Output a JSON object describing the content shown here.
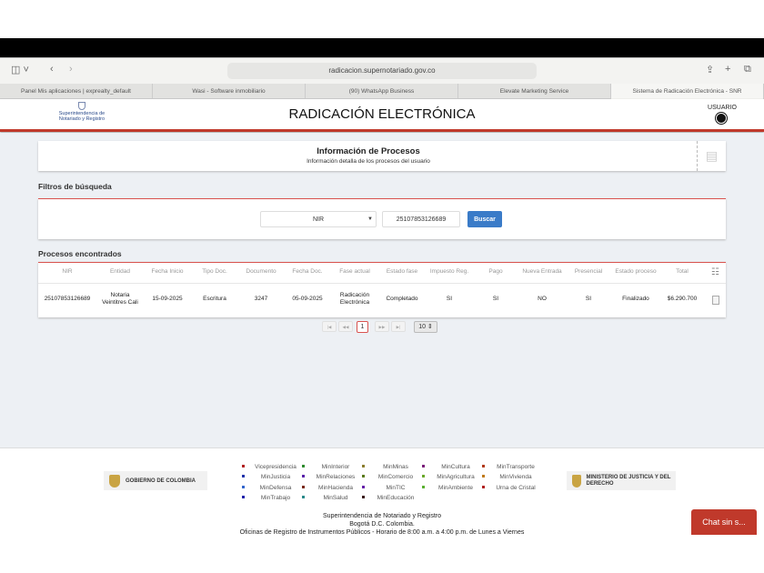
{
  "browser": {
    "url": "radicacion.supernotariado.gov.co",
    "tabs": [
      {
        "label": "Panel Mis aplicaciones | exprealty_default"
      },
      {
        "label": "Wasi - Software inmobiliario"
      },
      {
        "label": "(90) WhatsApp Business"
      },
      {
        "label": "Elevate Marketing Service"
      },
      {
        "label": "Sistema de Radicación Electrónica - SNR"
      }
    ]
  },
  "header": {
    "logo": "Superintendencia de Notariado y Registro",
    "title": "RADICACIÓN ELECTRÓNICA",
    "user": "USUARIO"
  },
  "info": {
    "title": "Información de Procesos",
    "subtitle": "Información detalla de los procesos del usuario"
  },
  "filters": {
    "heading": "Filtros de búsqueda",
    "select_value": "NIR",
    "input_value": "25107853126689",
    "search_label": "Buscar"
  },
  "results": {
    "heading": "Procesos encontrados",
    "columns": [
      "NIR",
      "Entidad",
      "Fecha Inicio",
      "Tipo Doc.",
      "Documento",
      "Fecha Doc.",
      "Fase actual",
      "Estado fase",
      "Impuesto Reg.",
      "Pago",
      "Nueva Entrada",
      "Presencial",
      "Estado proceso",
      "Total"
    ],
    "rows": [
      [
        "25107853126689",
        "Notaria Veintitres Cali",
        "15-09-2025",
        "Escritura",
        "3247",
        "05-09-2025",
        "Radicación Electrónica",
        "Completado",
        "SI",
        "SI",
        "NO",
        "SI",
        "Finalizado",
        "$6.290.700"
      ]
    ]
  },
  "pagination": {
    "first": "|◀",
    "prev": "◀◀",
    "current": "1",
    "next": "▶▶",
    "last": "▶|",
    "page_size": "10"
  },
  "footer": {
    "gov_left": "GOBIERNO DE COLOMBIA",
    "gov_right": "MINISTERIO DE JUSTICIA Y DEL DERECHO",
    "ministries": [
      {
        "label": "Vicepresidencia",
        "color": "#b22222"
      },
      {
        "label": "MinInterior",
        "color": "#2e8b2e"
      },
      {
        "label": "MinMinas",
        "color": "#8b7d2e"
      },
      {
        "label": "MinCultura",
        "color": "#7a1f7a"
      },
      {
        "label": "MinTransporte",
        "color": "#b23a1a"
      },
      {
        "label": "MinJusticia",
        "color": "#2233aa"
      },
      {
        "label": "MinRelaciones",
        "color": "#5a22aa"
      },
      {
        "label": "MinComercio",
        "color": "#5a7a1a"
      },
      {
        "label": "MinAgricultura",
        "color": "#6aa82a"
      },
      {
        "label": "MinVivienda",
        "color": "#c07a1a"
      },
      {
        "label": "MinDefensa",
        "color": "#3366cc"
      },
      {
        "label": "MinHacienda",
        "color": "#7a2a1a"
      },
      {
        "label": "MinTIC",
        "color": "#6622aa"
      },
      {
        "label": "MinAmbiente",
        "color": "#5ab030"
      },
      {
        "label": "Urna de Cristal",
        "color": "#b22222"
      },
      {
        "label": "MinTrabajo",
        "color": "#2222aa"
      },
      {
        "label": "MinSalud",
        "color": "#2a8a8a"
      },
      {
        "label": "MinEducación",
        "color": "#3a1a1a"
      }
    ],
    "address": [
      "Superintendencia de Notariado y Registro",
      "Bogotá D.C. Colombia.",
      "Oficinas de Registro de Instrumentos Públicos - Horario de 8:00 a.m. a 4:00 p.m. de Lunes a Viernes"
    ],
    "chat": "Chat sin s..."
  }
}
